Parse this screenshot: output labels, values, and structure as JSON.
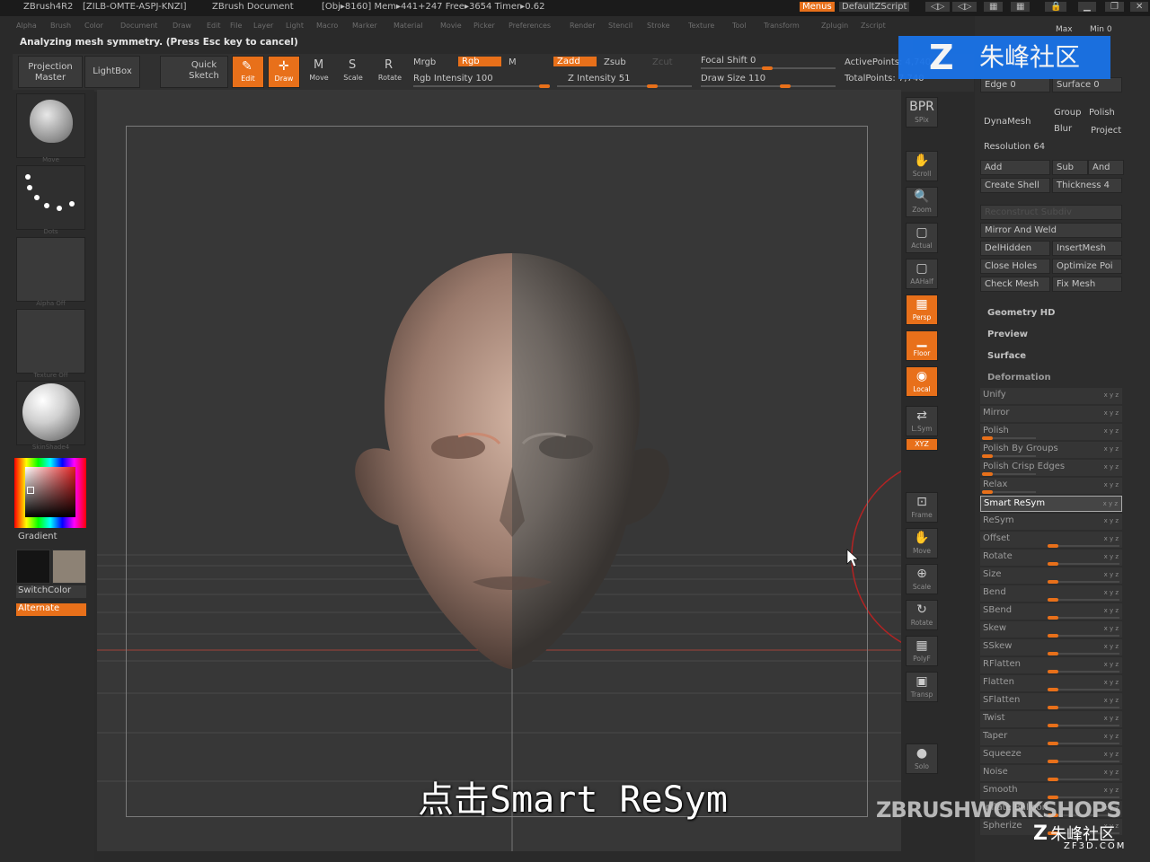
{
  "titlebar": {
    "app": "ZBrush4R2",
    "build": "[ZILB-OMTE-ASPJ-KNZI]",
    "doc": "ZBrush Document",
    "obj": "[Obj▸8160] Mem▸441+247 Free▸3654 Timer▸0.62",
    "menus": "Menus",
    "script": "DefaultZScript"
  },
  "menubar": [
    "Alpha",
    "Brush",
    "Color",
    "Document",
    "Draw",
    "Edit",
    "File",
    "Layer",
    "Light",
    "Macro",
    "Marker",
    "Material",
    "Movie",
    "Picker",
    "Preferences",
    "Render",
    "Stencil",
    "Stroke",
    "Texture",
    "Tool",
    "Transform",
    "Zplugin",
    "Zscript"
  ],
  "status": "Analyzing mesh symmetry. (Press Esc key to cancel)",
  "shelf": {
    "projection": "Projection\nMaster",
    "lightbox": "LightBox",
    "quicksketch": "Quick\nSketch",
    "edit": "Edit",
    "draw": "Draw",
    "move": "Move",
    "scale": "Scale",
    "rotate": "Rotate",
    "mrgb": "Mrgb",
    "rgb": "Rgb",
    "m": "M",
    "rgb_intensity": "Rgb Intensity 100",
    "zadd": "Zadd",
    "zsub": "Zsub",
    "zcut": "Zcut",
    "z_intensity": "Z Intensity 51",
    "focal_shift": "Focal Shift 0",
    "draw_size": "Draw Size 110",
    "active_points": "ActivePoints: 4,740",
    "total_points": "TotalPoints: 7,740"
  },
  "leftpanel": {
    "brush_label": "Move",
    "stroke_label": "Dots",
    "alpha_label": "Alpha Off",
    "texture_label": "Texture Off",
    "material_label": "SkinShade4",
    "gradient": "Gradient",
    "switchcolor": "SwitchColor",
    "alternate": "Alternate"
  },
  "righttools": [
    {
      "icon": "BPR",
      "label": "SPix"
    },
    {
      "icon": "✋",
      "label": "Scroll"
    },
    {
      "icon": "🔍",
      "label": "Zoom"
    },
    {
      "icon": "▢",
      "label": "Actual"
    },
    {
      "icon": "▢",
      "label": "AAHalf"
    },
    {
      "icon": "▦",
      "label": "Persp"
    },
    {
      "icon": "▁",
      "label": "Floor"
    },
    {
      "icon": "◉",
      "label": "Local"
    },
    {
      "icon": "⇄",
      "label": "L.Sym"
    },
    {
      "icon": "XYZ",
      "label": "Qxyz"
    },
    {
      "icon": "⊡",
      "label": "Frame"
    },
    {
      "icon": "✋",
      "label": "Move"
    },
    {
      "icon": "⊕",
      "label": "Scale"
    },
    {
      "icon": "↻",
      "label": "Rotate"
    },
    {
      "icon": "▦",
      "label": "PolyF"
    },
    {
      "icon": "▣",
      "label": "Transp"
    },
    {
      "icon": "●",
      "label": "Solo"
    }
  ],
  "rightpanel": {
    "max": "Max",
    "min": "Min 0",
    "edge": "Edge 0",
    "surface": "Surface 0",
    "dynamesh": "DynaMesh",
    "group": "Group",
    "polish": "Polish",
    "blur": "Blur",
    "project": "Project",
    "resolution": "Resolution 64",
    "add": "Add",
    "sub": "Sub",
    "and": "And",
    "create_shell": "Create Shell",
    "thickness": "Thickness 4",
    "reconstruct": "Reconstruct Subdiv",
    "mirror_weld": "Mirror And Weld",
    "delhidden": "DelHidden",
    "insertmesh": "InsertMesh",
    "close_holes": "Close Holes",
    "optimize": "Optimize Poi",
    "check_mesh": "Check Mesh",
    "fix_mesh": "Fix Mesh",
    "geometry_hd": "Geometry HD",
    "preview": "Preview",
    "surface_sec": "Surface",
    "deformation": "Deformation",
    "deform_rows": [
      "Unify",
      "Mirror",
      "Polish",
      "Polish By Groups",
      "Polish Crisp Edges",
      "Relax",
      "Smart ReSym",
      "ReSym",
      "Offset",
      "Rotate",
      "Size",
      "Bend",
      "SBend",
      "Skew",
      "SSkew",
      "RFlatten",
      "Flatten",
      "SFlatten",
      "Twist",
      "Taper",
      "Squeeze",
      "Noise",
      "Smooth",
      "Inflate Balloon",
      "Spherize"
    ]
  },
  "watermark": "朱峰社区",
  "subtitle": "点击Smart ReSym",
  "zbw": "ZBRUSHWORKSHOPS",
  "corner": {
    "brand": "朱峰社区",
    "url": "ZF3D.COM"
  }
}
